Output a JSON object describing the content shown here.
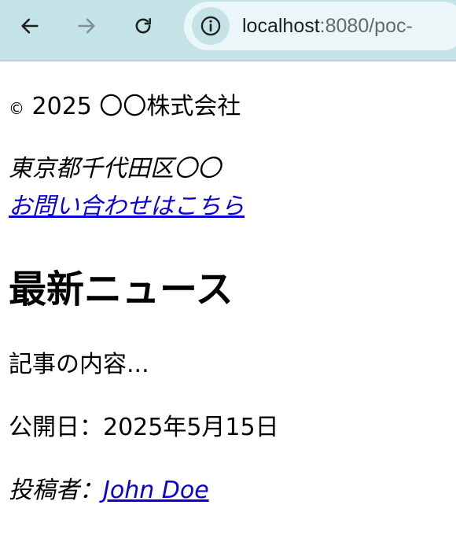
{
  "browser": {
    "url_host": "localhost",
    "url_path": ":8080/poc-",
    "icons": {
      "back": "arrow-left-icon",
      "forward": "arrow-right-icon",
      "reload": "reload-icon",
      "info": "info-icon"
    },
    "colors": {
      "toolbar": "#c4e3e6",
      "omnibox": "#eaf6f7"
    }
  },
  "page": {
    "copyright_symbol": "©",
    "copyright_text": " 2025 〇〇株式会社",
    "address": "東京都千代田区〇〇",
    "contact_link": "お問い合わせはこちら",
    "heading": "最新ニュース",
    "article_body": "記事の内容...",
    "publish_date": "公開日：2025年5月15日",
    "author_label": "投稿者：",
    "author_name": "John Doe",
    "link_color": "#0b00d8"
  }
}
